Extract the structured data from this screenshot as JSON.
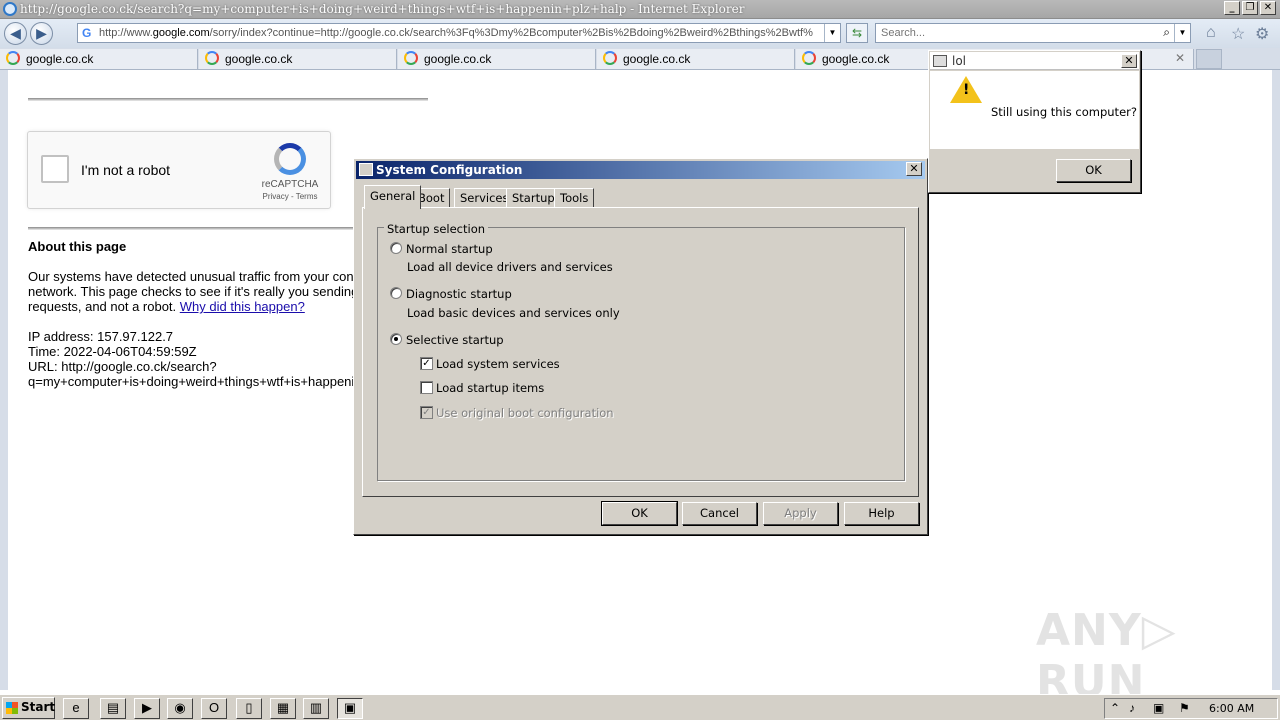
{
  "window": {
    "title": "http://google.co.ck/search?q=my+computer+is+doing+weird+things+wtf+is+happenin+plz+halp - Internet Explorer",
    "minimize": "_",
    "restore": "❐",
    "close": "✕"
  },
  "address_bar": {
    "url_prefix": "http://www.",
    "url_domain": "google.com",
    "url_rest": "/sorry/index?continue=http://google.co.ck/search%3Fq%3Dmy%2Bcomputer%2Bis%2Bdoing%2Bweird%2Bthings%2Bwtf%",
    "dropdown": "▼"
  },
  "search_box": {
    "placeholder": "Search...",
    "dropdown": "▼"
  },
  "toolbar_icons": [
    "home-icon",
    "star-icon",
    "gear-icon"
  ],
  "tabs": [
    {
      "label": "google.co.ck"
    },
    {
      "label": "google.co.ck"
    },
    {
      "label": "google.co.ck"
    },
    {
      "label": "google.co.ck"
    },
    {
      "label": "google.co.ck"
    }
  ],
  "tab_close": "✕",
  "captcha": {
    "label": "I'm not a robot",
    "brand": "reCAPTCHA",
    "links": "Privacy - Terms"
  },
  "page": {
    "about_title": "About this page",
    "p1_line1": "Our systems have detected unusual traffic from your con",
    "p1_line2": "network. This page checks to see if it's really you sending",
    "p1_line3_text": "requests, and not a robot. ",
    "p1_link": "Why did this happen?",
    "ip": "IP address: 157.97.122.7",
    "time": "Time: 2022-04-06T04:59:59Z",
    "url_line1": "URL: http://google.co.ck/search?",
    "url_line2": "q=my+computer+is+doing+weird+things+wtf+is+happeni"
  },
  "msconfig": {
    "title": "System Configuration",
    "tabs": [
      "General",
      "Boot",
      "Services",
      "Startup",
      "Tools"
    ],
    "group_label": "Startup selection",
    "normal": {
      "label": "Normal startup",
      "desc": "Load all device drivers and services",
      "selected": false
    },
    "diagnostic": {
      "label": "Diagnostic startup",
      "desc": "Load basic devices and services only",
      "selected": false
    },
    "selective": {
      "label": "Selective startup",
      "selected": true
    },
    "options": [
      {
        "label": "Load system services",
        "checked": true,
        "enabled": true
      },
      {
        "label": "Load startup items",
        "checked": false,
        "enabled": true
      },
      {
        "label": "Use original boot configuration",
        "checked": true,
        "enabled": false
      }
    ],
    "buttons": {
      "ok": "OK",
      "cancel": "Cancel",
      "apply": "Apply",
      "help": "Help"
    },
    "check_glyph": "✓"
  },
  "lol_dialog": {
    "title": "lol",
    "message": "Still using this computer?",
    "ok": "OK"
  },
  "taskbar": {
    "start": "Start",
    "clock": "6:00 AM"
  },
  "watermark": {
    "left": "ANY",
    "right": "RUN"
  },
  "colors": {
    "dialog_face": "#d4d0c8",
    "title_gradient_start": "#0a246a",
    "link": "#1a0dab",
    "warning": "#f3c21b"
  }
}
